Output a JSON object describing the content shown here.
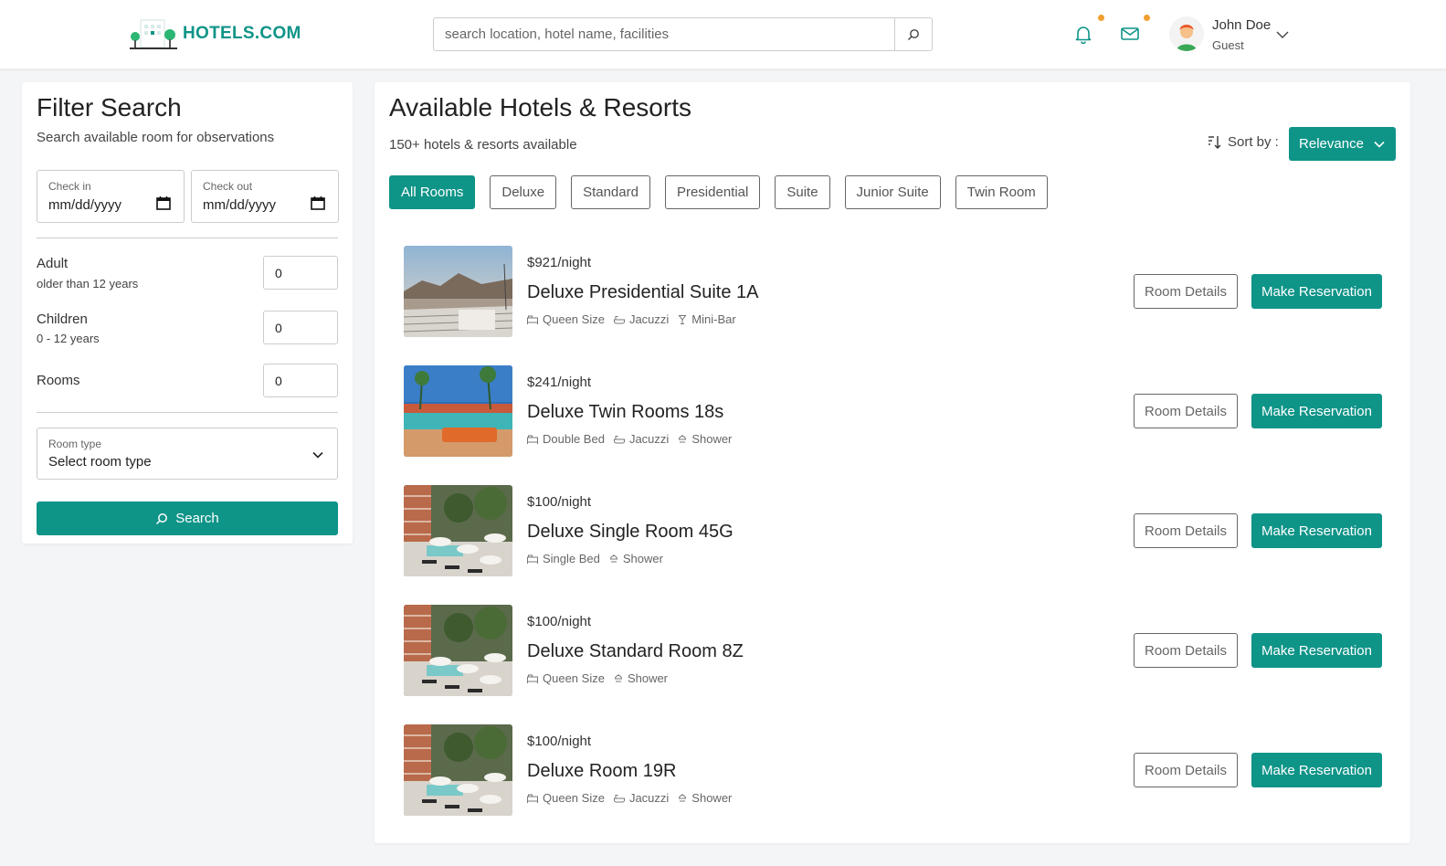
{
  "brand": {
    "name": "HOTELS.COM",
    "accent": "#0f9488"
  },
  "header": {
    "search_placeholder": "search location, hotel name, facilities",
    "user_name": "John Doe",
    "user_role": "Guest"
  },
  "filter": {
    "title": "Filter Search",
    "subtitle": "Search available room for observations",
    "checkin_label": "Check in",
    "checkin_value": "mm/dd/yyyy",
    "checkout_label": "Check out",
    "checkout_value": "mm/dd/yyyy",
    "adult_label": "Adult",
    "adult_sub": "older than 12 years",
    "adult_value": "0",
    "children_label": "Children",
    "children_sub": "0 - 12 years",
    "children_value": "0",
    "rooms_label": "Rooms",
    "rooms_value": "0",
    "roomtype_label": "Room type",
    "roomtype_value": "Select room type",
    "search_label": "Search"
  },
  "results": {
    "title": "Available Hotels & Resorts",
    "subtitle": "150+ hotels & resorts available",
    "sort_label": "Sort by :",
    "sort_value": "Relevance",
    "tabs": [
      "All Rooms",
      "Deluxe",
      "Standard",
      "Presidential",
      "Suite",
      "Junior Suite",
      "Twin Room"
    ],
    "details_label": "Room Details",
    "reserve_label": "Make Reservation",
    "hotels": [
      {
        "price": "$921/night",
        "name": "Deluxe Presidential Suite 1A",
        "image": "mountain-resort",
        "amenities": [
          {
            "icon": "bed-icon",
            "label": "Queen Size"
          },
          {
            "icon": "bath-icon",
            "label": "Jacuzzi"
          },
          {
            "icon": "glass-icon",
            "label": "Mini-Bar"
          }
        ]
      },
      {
        "price": "$241/night",
        "name": "Deluxe Twin Rooms 18s",
        "image": "pool-resort",
        "amenities": [
          {
            "icon": "bed-icon",
            "label": "Double Bed"
          },
          {
            "icon": "bath-icon",
            "label": "Jacuzzi"
          },
          {
            "icon": "shower-icon",
            "label": "Shower"
          }
        ]
      },
      {
        "price": "$100/night",
        "name": "Deluxe Single Room 45G",
        "image": "hotel-pool",
        "amenities": [
          {
            "icon": "bed-icon",
            "label": "Single Bed"
          },
          {
            "icon": "shower-icon",
            "label": "Shower"
          }
        ]
      },
      {
        "price": "$100/night",
        "name": "Deluxe Standard Room 8Z",
        "image": "hotel-pool",
        "amenities": [
          {
            "icon": "bed-icon",
            "label": "Queen Size"
          },
          {
            "icon": "shower-icon",
            "label": "Shower"
          }
        ]
      },
      {
        "price": "$100/night",
        "name": "Deluxe Room 19R",
        "image": "hotel-pool",
        "amenities": [
          {
            "icon": "bed-icon",
            "label": "Queen Size"
          },
          {
            "icon": "bath-icon",
            "label": "Jacuzzi"
          },
          {
            "icon": "shower-icon",
            "label": "Shower"
          }
        ]
      }
    ]
  }
}
